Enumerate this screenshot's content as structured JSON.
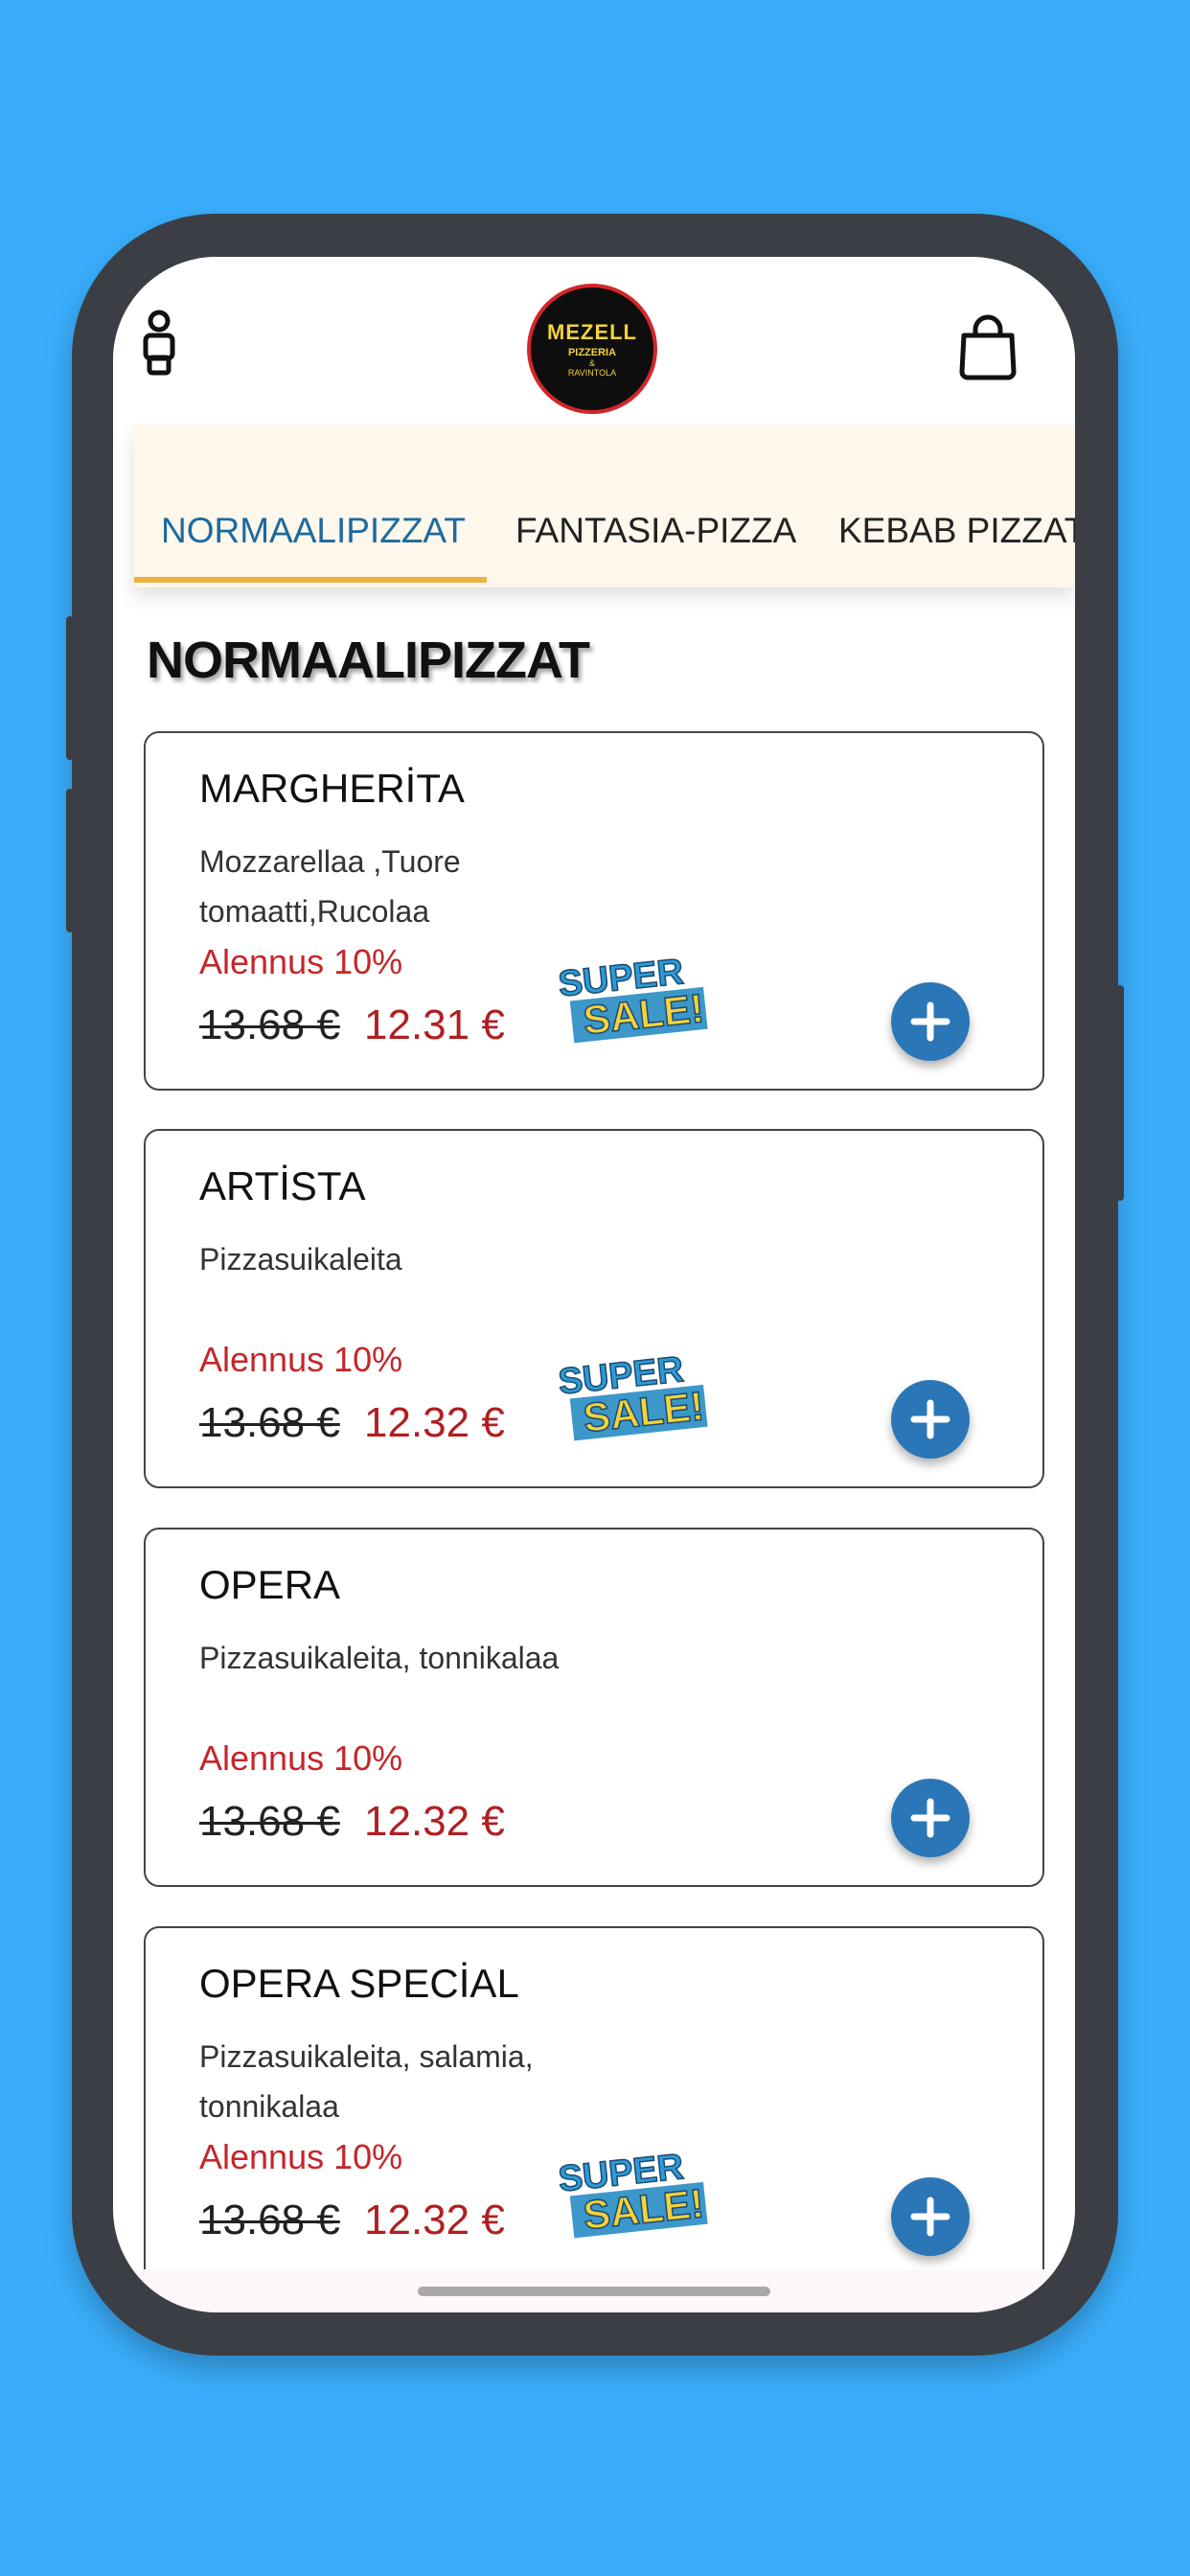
{
  "header": {
    "logo": {
      "line1": "MEZELL",
      "line2": "PIZZERIA",
      "line3": "&",
      "line4": "RAVINTOLA"
    },
    "user_icon": "person-icon",
    "cart_icon": "shopping-bag-icon"
  },
  "tabs": [
    {
      "label": "NORMAALIPIZZAT",
      "active": true
    },
    {
      "label": "FANTASIA-PIZZA",
      "active": false
    },
    {
      "label": "KEBAB PIZZAT",
      "active": false
    }
  ],
  "section_title": "NORMAALIPIZZAT",
  "products": [
    {
      "name": "MARGHERİTA",
      "description": "Mozzarellaa ,Tuore tomaatti,Rucolaa",
      "discount": "Alennus 10%",
      "old_price": "13.68 €",
      "new_price": "12.31 €",
      "sale_badge": [
        "SUPER",
        "SALE!"
      ]
    },
    {
      "name": "ARTİSTA",
      "description": "Pizzasuikaleita",
      "discount": "Alennus 10%",
      "old_price": "13.68 €",
      "new_price": "12.32 €",
      "sale_badge": [
        "SUPER",
        "SALE!"
      ]
    },
    {
      "name": "OPERA",
      "description": "Pizzasuikaleita, tonnikalaa",
      "discount": "Alennus 10%",
      "old_price": "13.68 €",
      "new_price": "12.32 €",
      "sale_badge": null
    },
    {
      "name": "OPERA SPECİAL",
      "description": "Pizzasuikaleita, salamia, tonnikalaa",
      "discount": "Alennus 10%",
      "old_price": "13.68 €",
      "new_price": "12.32 €",
      "sale_badge": [
        "SUPER",
        "SALE!"
      ]
    }
  ],
  "colors": {
    "background": "#3aaefc",
    "accent_blue": "#2b76b6",
    "tab_active": "#1b6a9e",
    "tab_underline": "#f0b040",
    "discount_red": "#c4262a",
    "price_red": "#b01f22"
  }
}
